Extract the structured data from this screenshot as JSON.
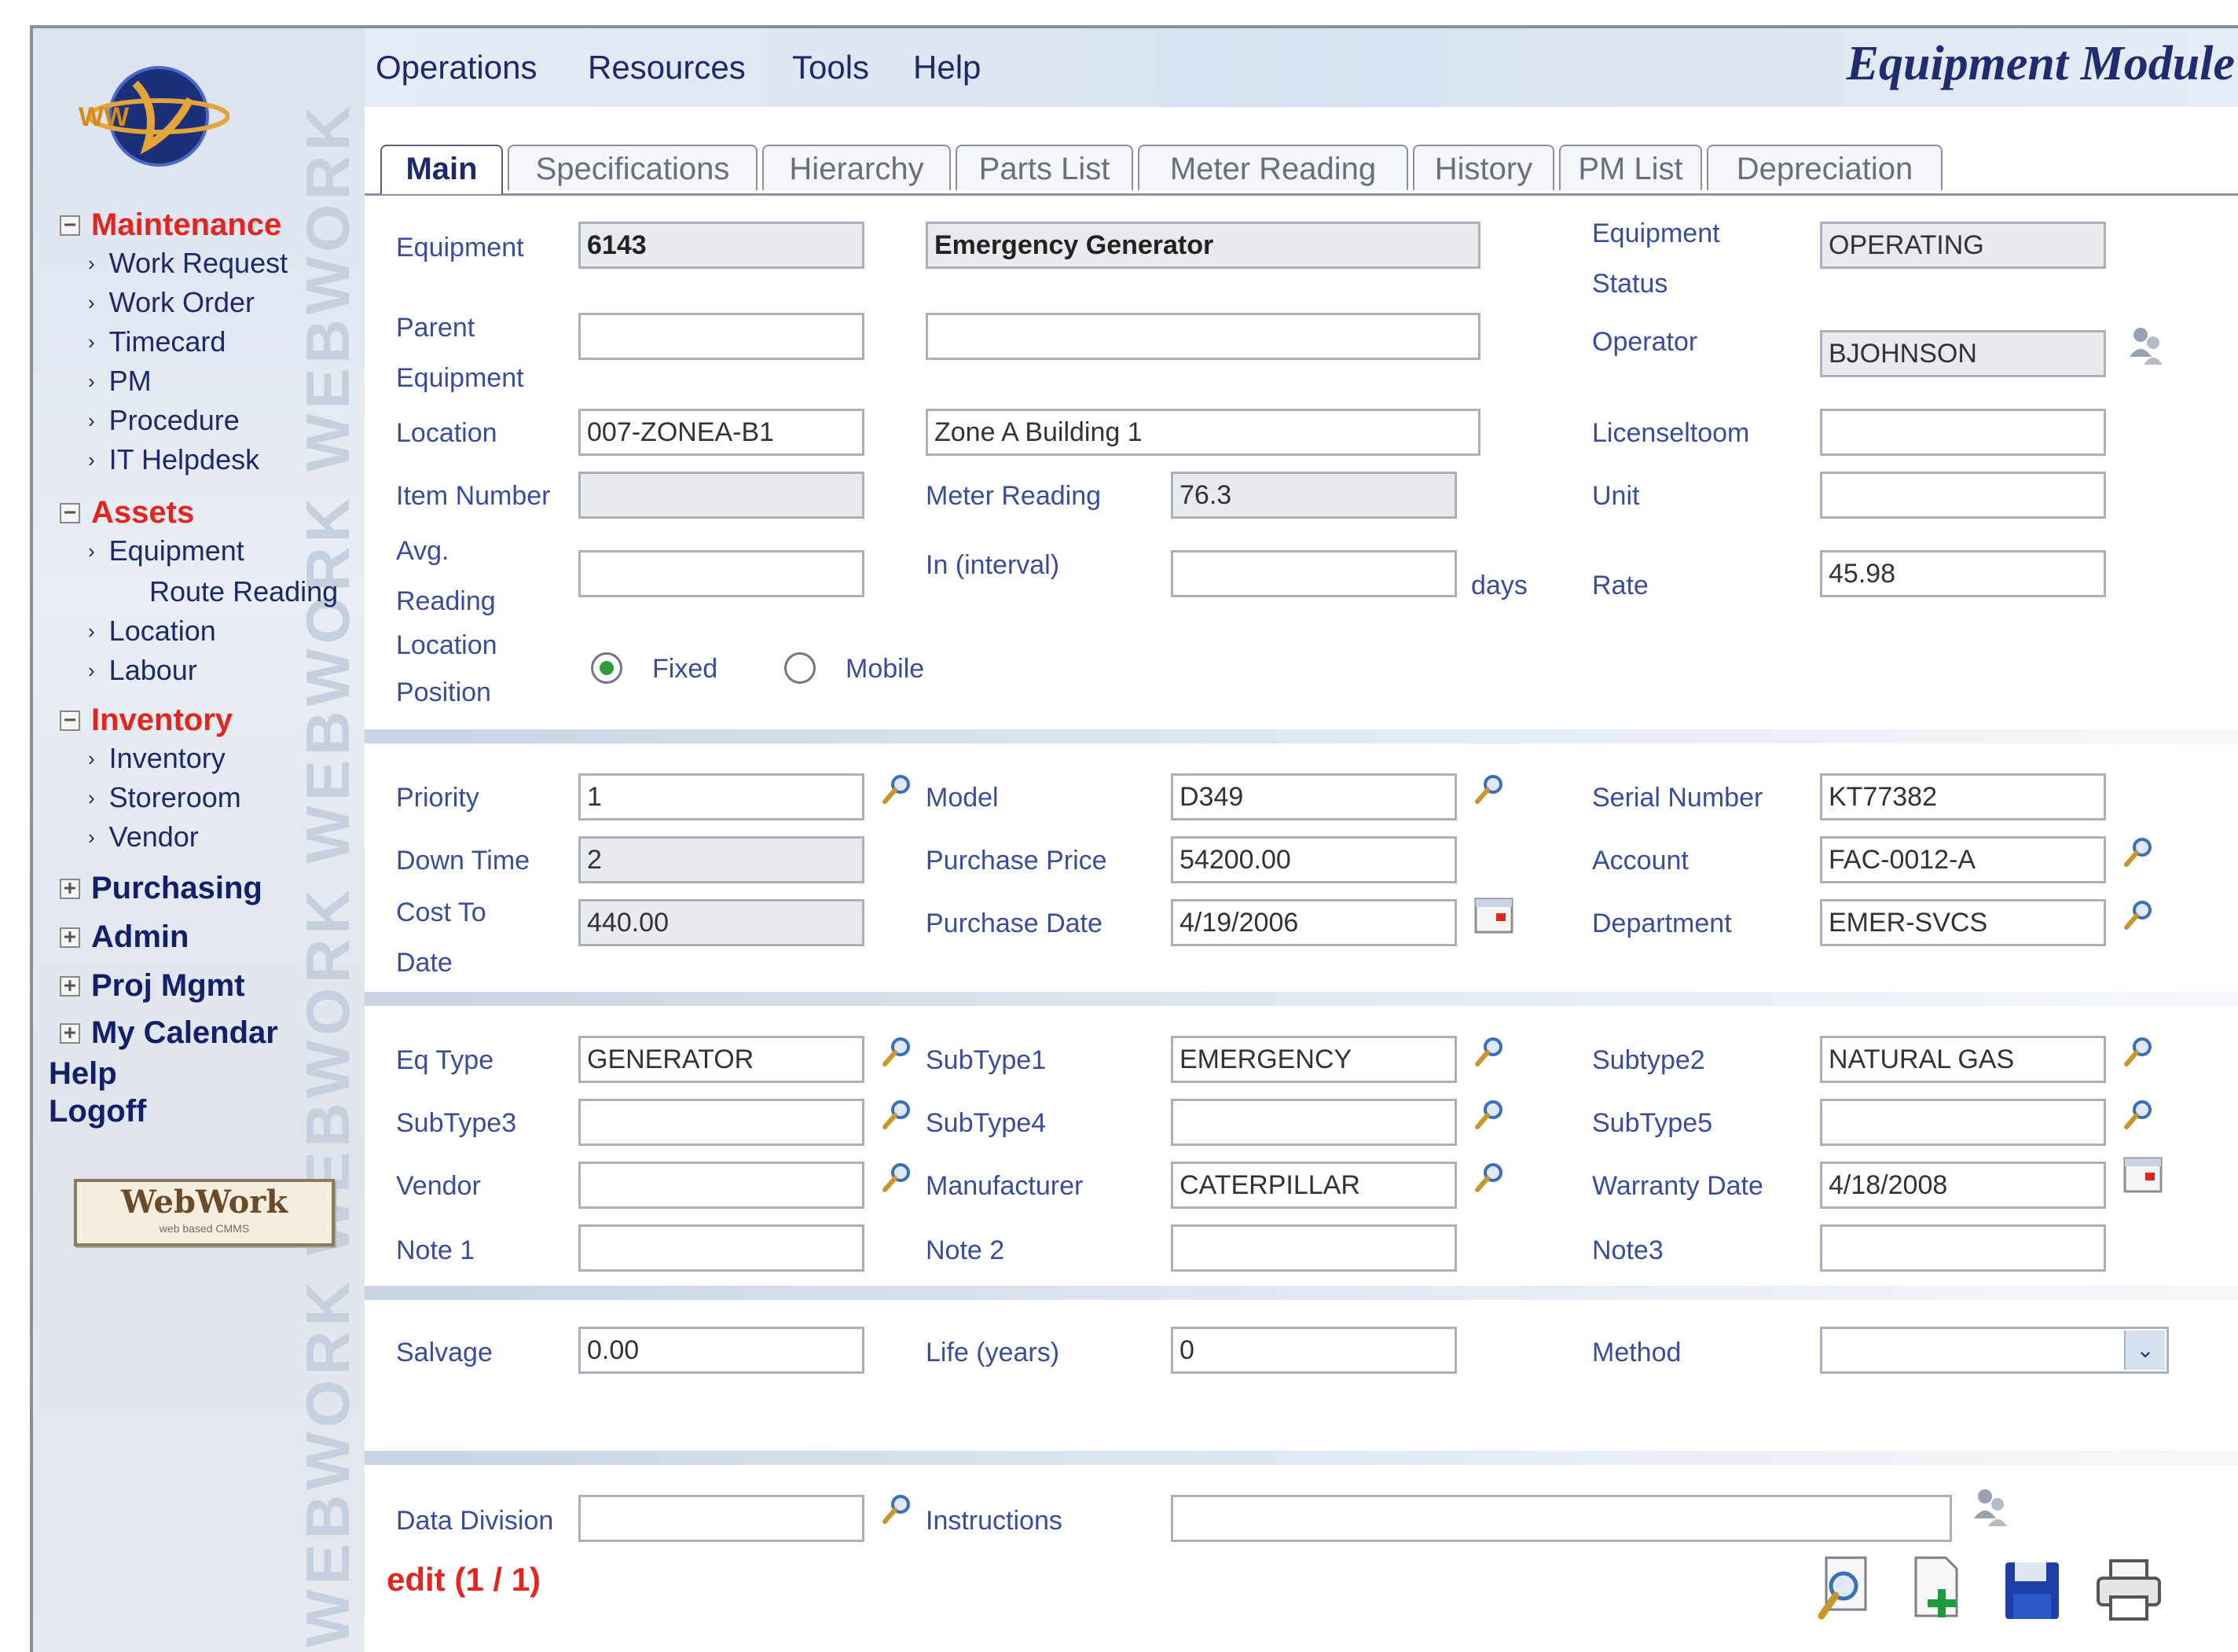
{
  "sidebar": {
    "logo_text": "WW",
    "watermark": "WEBWORK WEBWORK WEBWORK WEBWORK",
    "sections": [
      {
        "label": "Maintenance",
        "toggle": "−",
        "items": [
          "Work Request",
          "Work Order",
          "Timecard",
          "PM",
          "Procedure",
          "IT Helpdesk"
        ]
      },
      {
        "label": "Assets",
        "toggle": "−",
        "items": [
          "Equipment",
          "Route Reading",
          "Location",
          "Labour"
        ]
      },
      {
        "label": "Inventory",
        "toggle": "−",
        "items": [
          "Inventory",
          "Storeroom",
          "Vendor"
        ]
      },
      {
        "label": "Purchasing",
        "toggle": "+"
      },
      {
        "label": "Admin",
        "toggle": "+"
      },
      {
        "label": "Proj Mgmt",
        "toggle": "+"
      },
      {
        "label": "My Calendar",
        "toggle": "+"
      }
    ],
    "links": [
      "Help",
      "Logoff"
    ],
    "badge_title": "WebWork",
    "badge_sub": "web based CMMS"
  },
  "menu": [
    "Operations",
    "Resources",
    "Tools",
    "Help"
  ],
  "module_title": "Equipment Module",
  "tabs": [
    "Main",
    "Specifications",
    "Hierarchy",
    "Parts List",
    "Meter Reading",
    "History",
    "PM List",
    "Depreciation"
  ],
  "main": {
    "equipment_label": "Equipment",
    "equipment_value": "6143",
    "equipment_desc": "Emergency Generator",
    "status_label_1": "Equipment",
    "status_label_2": "Status",
    "status_value": "OPERATING",
    "parent_label_1": "Parent",
    "parent_label_2": "Equipment",
    "parent_value": "",
    "parent_desc": "",
    "operator_label": "Operator",
    "operator_value": "BJOHNSON",
    "location_label": "Location",
    "location_value": "007-ZONEA-B1",
    "location_desc": "Zone A Building 1",
    "license_label": "Licenseltoom",
    "license_value": "",
    "item_label": "Item Number",
    "item_value": "",
    "meter_label": "Meter Reading",
    "meter_value": "76.3",
    "unit_label": "Unit",
    "unit_value": "",
    "avg_label_1": "Avg.",
    "avg_label_2": "Reading",
    "avg_value": "",
    "interval_label": "In (interval)",
    "interval_value": "",
    "days_label": "days",
    "rate_label": "Rate",
    "rate_value": "45.98",
    "locpos_label_1": "Location",
    "locpos_label_2": "Position",
    "radio_fixed": "Fixed",
    "radio_mobile": "Mobile"
  },
  "section2": {
    "priority_label": "Priority",
    "priority_value": "1",
    "model_label": "Model",
    "model_value": "D349",
    "serial_label": "Serial Number",
    "serial_value": "KT77382",
    "down_label": "Down Time",
    "down_value": "2",
    "price_label": "Purchase Price",
    "price_value": "54200.00",
    "account_label": "Account",
    "account_value": "FAC-0012-A",
    "cost_label_1": "Cost To",
    "cost_label_2": "Date",
    "cost_value": "440.00",
    "pdate_label": "Purchase Date",
    "pdate_value": "4/19/2006",
    "dept_label": "Department",
    "dept_value": "EMER-SVCS"
  },
  "section3": {
    "eqtype_label": "Eq Type",
    "eqtype_value": "GENERATOR",
    "sub1_label": "SubType1",
    "sub1_value": "EMERGENCY",
    "sub2_label": "Subtype2",
    "sub2_value": "NATURAL GAS",
    "sub3_label": "SubType3",
    "sub3_value": "",
    "sub4_label": "SubType4",
    "sub4_value": "",
    "sub5_label": "SubType5",
    "sub5_value": "",
    "vendor_label": "Vendor",
    "vendor_value": "",
    "mfr_label": "Manufacturer",
    "mfr_value": "CATERPILLAR",
    "warranty_label": "Warranty Date",
    "warranty_value": "4/18/2008",
    "note1_label": "Note 1",
    "note1_value": "",
    "note2_label": "Note 2",
    "note2_value": "",
    "note3_label": "Note3",
    "note3_value": ""
  },
  "section4": {
    "salvage_label": "Salvage",
    "salvage_value": "0.00",
    "life_label": "Life (years)",
    "life_value": "0",
    "method_label": "Method",
    "method_value": ""
  },
  "section5": {
    "division_label": "Data Division",
    "division_value": "",
    "instr_label": "Instructions",
    "instr_value": "",
    "status_text": "edit (1 / 1)"
  },
  "colors": {
    "accent_red": "#e0261e",
    "label_blue": "#3a4d9a",
    "nav_navy": "#12206a"
  }
}
